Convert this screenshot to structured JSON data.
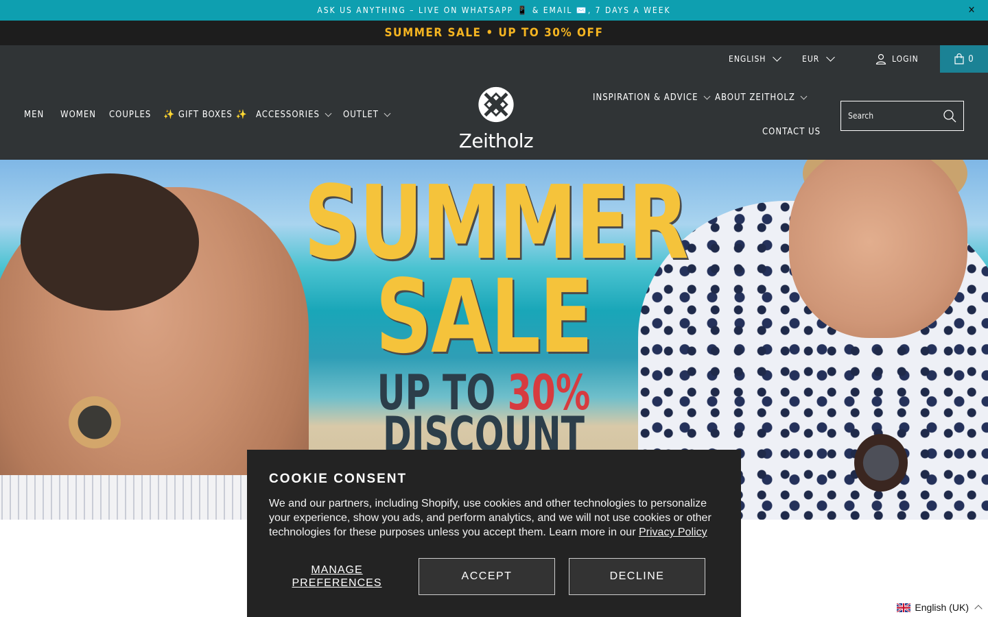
{
  "announcement": {
    "text": "ASK US ANYTHING – LIVE ON WHATSAPP 📱 & EMAIL ✉️, 7 DAYS A WEEK",
    "close_symbol": "✕"
  },
  "sale_banner": {
    "text": "SUMMER SALE • UP TO 30% OFF"
  },
  "utility": {
    "language": "ENGLISH",
    "currency": "EUR",
    "login": "LOGIN",
    "cart_count": "0"
  },
  "nav": {
    "men": "MEN",
    "women": "WOMEN",
    "couples": "COUPLES",
    "gift_boxes": "✨ GIFT BOXES ✨",
    "accessories": "ACCESSORIES",
    "outlet": "OUTLET",
    "inspiration": "INSPIRATION & ADVICE",
    "about": "ABOUT ZEITHOLZ",
    "contact": "CONTACT US"
  },
  "logo": {
    "text": "Zeitholz"
  },
  "search": {
    "placeholder": "Search"
  },
  "hero": {
    "line1": "SUMMER",
    "line2": "SALE",
    "line3_prefix": "UP TO",
    "line3_percent": "30%",
    "line4": "DISCOUNT"
  },
  "cookie": {
    "title": "COOKIE CONSENT",
    "body": "We and our partners, including Shopify, use cookies and other technologies to personalize your experience, show you ads, and perform analytics, and we will not use cookies or other technologies for these purposes unless you accept them. Learn more in our ",
    "link": "Privacy Policy",
    "manage": "MANAGE PREFERENCES",
    "accept": "ACCEPT",
    "decline": "DECLINE"
  },
  "language_switcher": {
    "label": "English (UK)"
  },
  "colors": {
    "announcement_bg": "#0e9fb0",
    "header_bg": "#303436",
    "sale_text": "#f5b521",
    "cart_bg": "#1b8295",
    "hero_yellow": "#f5c33b",
    "hero_red": "#d73b3f",
    "cookie_bg": "#232323"
  }
}
